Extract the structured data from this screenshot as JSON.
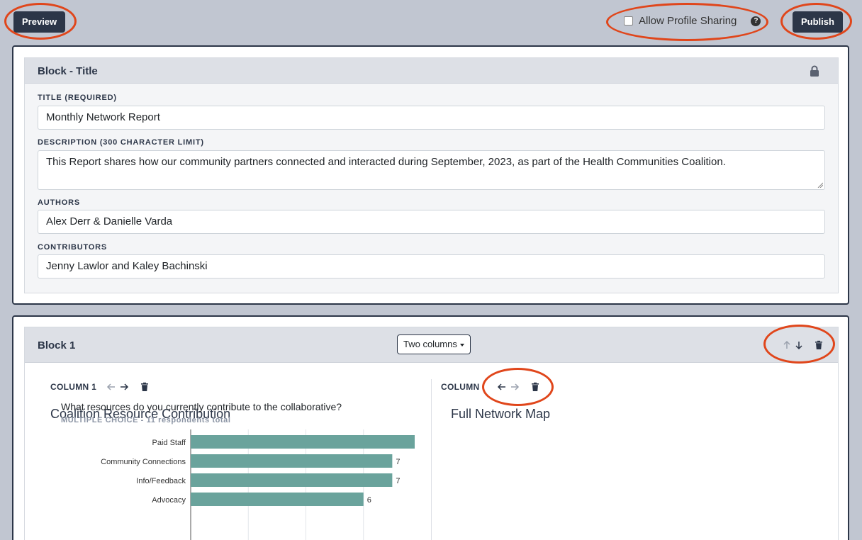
{
  "toolbar": {
    "preview_label": "Preview",
    "publish_label": "Publish",
    "allow_profile_sharing_label": "Allow Profile Sharing",
    "allow_profile_sharing_checked": false,
    "help_glyph": "?"
  },
  "title_block": {
    "heading": "Block - Title",
    "lock_icon": "lock-icon",
    "fields": {
      "title_label": "TITLE (REQUIRED)",
      "title_value": "Monthly Network Report",
      "description_label": "DESCRIPTION (300 CHARACTER LIMIT)",
      "description_value": "This Report shares how our community partners connected and interacted during September, 2023, as part of the Health Communities Coalition.",
      "authors_label": "AUTHORS",
      "authors_value": "Alex Derr & Danielle Varda",
      "contributors_label": "CONTRIBUTORS",
      "contributors_value": "Jenny Lawlor and Kaley Bachinski"
    }
  },
  "block1": {
    "heading": "Block 1",
    "layout_select": "Two columns",
    "column1": {
      "label": "COLUMN 1",
      "title": "Coalition Resource Contribution",
      "question": "What resources do you currently contribute to the collaborative?",
      "meta": "MULTIPLE CHOICE  -  11 respondents total"
    },
    "column2": {
      "label": "COLUMN",
      "title": "Full Network Map"
    }
  },
  "colors": {
    "background": "#c1c6d1",
    "dark": "#2c3648",
    "annotation_ring": "#e0461b",
    "bar": "#6aa39c"
  },
  "chart_data": {
    "type": "bar",
    "orientation": "horizontal",
    "categories": [
      "Paid Staff",
      "Community Connections",
      "Info/Feedback",
      "Advocacy"
    ],
    "values": [
      8,
      7,
      7,
      6
    ],
    "xlim": [
      0,
      8
    ],
    "grid": true
  }
}
